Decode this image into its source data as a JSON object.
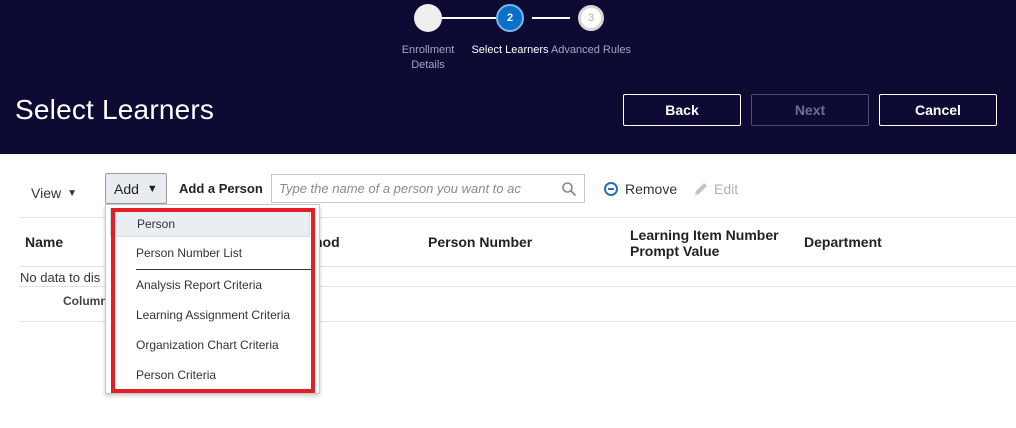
{
  "train": {
    "stops": [
      {
        "number": "",
        "label_line1": "Enrollment",
        "label_line2": "Details"
      },
      {
        "number": "2",
        "label": "Select Learners"
      },
      {
        "number": "3",
        "label": "Advanced Rules"
      }
    ]
  },
  "header": {
    "title": "Select Learners",
    "back_label": "Back",
    "next_label": "Next",
    "cancel_label": "Cancel"
  },
  "toolbar": {
    "view_label": "View",
    "add_label": "Add",
    "add_person_label": "Add a Person",
    "search_placeholder": "Type the name of a person you want to ac",
    "remove_label": "Remove",
    "edit_label": "Edit"
  },
  "table": {
    "columns": [
      "Name",
      "hod",
      "Person Number",
      "Learning Item Number",
      "Prompt Value",
      "Department"
    ],
    "no_data": "No data to dis",
    "columns_label": "Column"
  },
  "add_menu": {
    "items": [
      "Person",
      "Person Number List",
      "Analysis Report Criteria",
      "Learning Assignment Criteria",
      "Organization Chart Criteria",
      "Person Criteria"
    ]
  },
  "colors": {
    "header_bg": "#0d0b33",
    "accent": "#0a6fc9",
    "highlight": "#e31e24"
  }
}
